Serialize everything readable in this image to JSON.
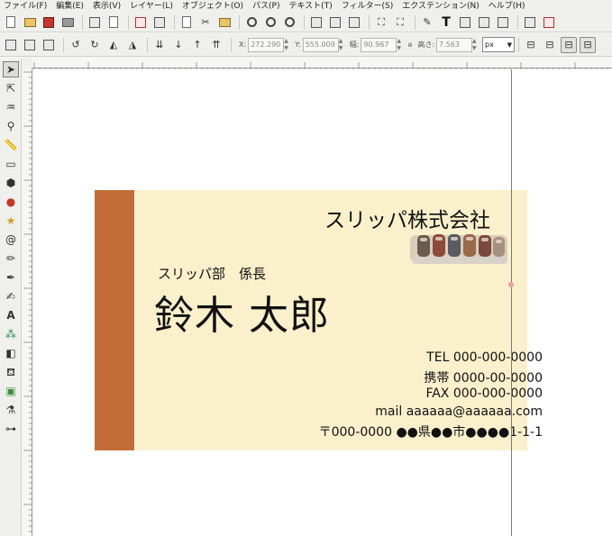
{
  "menu": {
    "items": [
      "ファイル(F)",
      "編集(E)",
      "表示(V)",
      "レイヤー(L)",
      "オブジェクト(O)",
      "パス(P)",
      "テキスト(T)",
      "フィルター(S)",
      "エクステンション(N)",
      "ヘルプ(H)"
    ]
  },
  "tool_controls": {
    "x_label": "X:",
    "x_value": "272.290",
    "y_label": "Y:",
    "y_value": "555.009",
    "w_label": "幅:",
    "w_value": "90.967",
    "lock_glyph": "a",
    "h_label": "高さ:",
    "h_value": "7.563",
    "unit": "px"
  },
  "card": {
    "company": "スリッパ株式会社",
    "department_title": "スリッパ部　係長",
    "name": "鈴木 太郎",
    "tel": "TEL 000-000-0000",
    "mobile": "携帯 0000-00-0000",
    "fax": "FAX 000-000-0000",
    "mail": "mail aaaaaa@aaaaaa.com",
    "address": "〒000-0000 ●●県●●市●●●●1-1-1"
  },
  "colors": {
    "card_background": "#fbf0cc",
    "card_accent_bar": "#c26d37",
    "selection_guide": "#7a7a7a"
  },
  "icons": {
    "toolbox": [
      "selector-icon",
      "node-editor-icon",
      "tweak-icon",
      "zoom-icon",
      "measure-icon",
      "rectangle-icon",
      "3d-box-icon",
      "ellipse-icon",
      "star-icon",
      "spiral-icon",
      "pencil-icon",
      "pen-icon",
      "calligraphy-icon",
      "text-icon",
      "spray-icon",
      "eraser-icon",
      "paint-bucket-icon",
      "gradient-icon",
      "dropper-icon",
      "connector-icon"
    ]
  }
}
